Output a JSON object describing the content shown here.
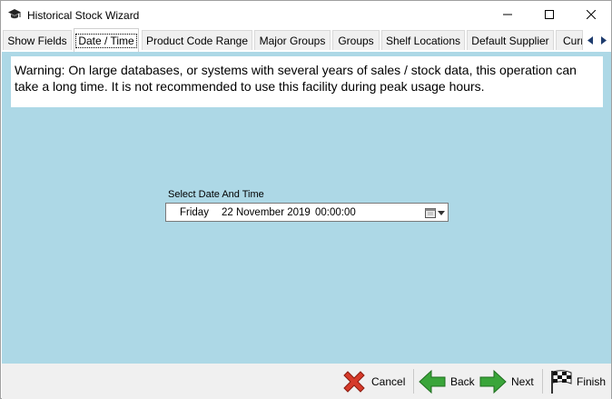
{
  "window": {
    "title": "Historical Stock Wizard"
  },
  "tabs": [
    {
      "label": "Show Fields"
    },
    {
      "label": "Date / Time"
    },
    {
      "label": "Product Code Range"
    },
    {
      "label": "Major Groups"
    },
    {
      "label": "Groups"
    },
    {
      "label": "Shelf Locations"
    },
    {
      "label": "Default Supplier"
    },
    {
      "label": "Curr"
    }
  ],
  "active_tab": "Date / Time",
  "warning": {
    "text": "Warning: On large databases, or systems with several years of sales / stock data, this operation can take a long time.  It is not recommended to use this facility during peak usage hours."
  },
  "date_picker": {
    "label": "Select Date And Time",
    "day": "Friday",
    "date": "22 November 2019",
    "time": "00:00:00"
  },
  "buttons": {
    "cancel": "Cancel",
    "back": "Back",
    "next": "Next",
    "finish": "Finish"
  },
  "colors": {
    "content_bg": "#add8e6",
    "cancel_red": "#d63a2a",
    "arrow_green": "#3aa53a"
  }
}
